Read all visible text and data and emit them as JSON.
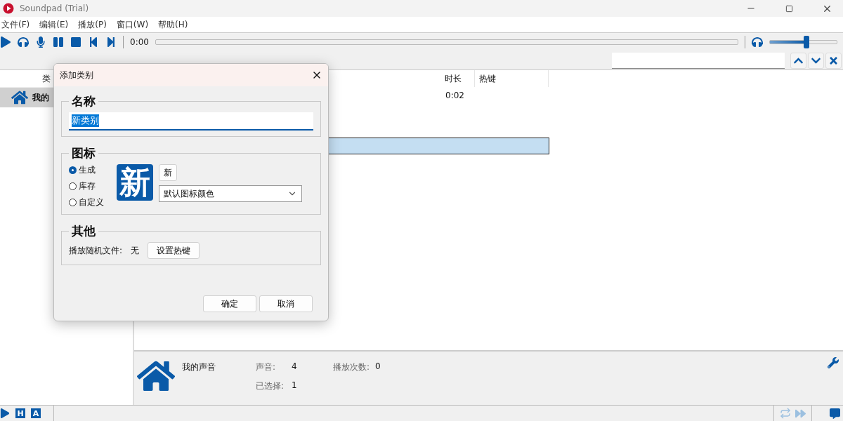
{
  "window": {
    "title": "Soundpad (Trial)"
  },
  "menu": [
    "文件(F)",
    "编辑(E)",
    "播放(P)",
    "窗口(W)",
    "帮助(H)"
  ],
  "toolbar": {
    "time": "0:00",
    "volume": {
      "level": 0.55
    }
  },
  "categories": {
    "header": "类",
    "items": [
      {
        "label": "我的",
        "selected": true
      }
    ]
  },
  "table": {
    "columns": [
      "时长",
      "热键"
    ],
    "rows": [
      {
        "duration": "0:02",
        "selected": false
      },
      {
        "selected": false
      },
      {
        "selected": false
      },
      {
        "selected": true
      }
    ]
  },
  "info": {
    "name": "我的声音",
    "stats": [
      {
        "label": "声音:",
        "value": "4"
      },
      {
        "label": "播放次数:",
        "value": "0"
      },
      {
        "label": "已选择:",
        "value": "1"
      }
    ]
  },
  "status_bar": {
    "keys": [
      "H",
      "A"
    ]
  },
  "dialog": {
    "title": "添加类别",
    "name_group": {
      "title": "名称",
      "value": "新类别"
    },
    "icon_group": {
      "title": "图标",
      "options": [
        {
          "label": "生成",
          "selected": true
        },
        {
          "label": "库存",
          "selected": false
        },
        {
          "label": "自定义",
          "selected": false
        }
      ],
      "preview": "新",
      "text_button": "新",
      "color_select": "默认图标颜色"
    },
    "other_group": {
      "title": "其他",
      "label": "播放随机文件:",
      "value": "无",
      "button": "设置热键"
    },
    "buttons": [
      "确定",
      "取消"
    ]
  }
}
